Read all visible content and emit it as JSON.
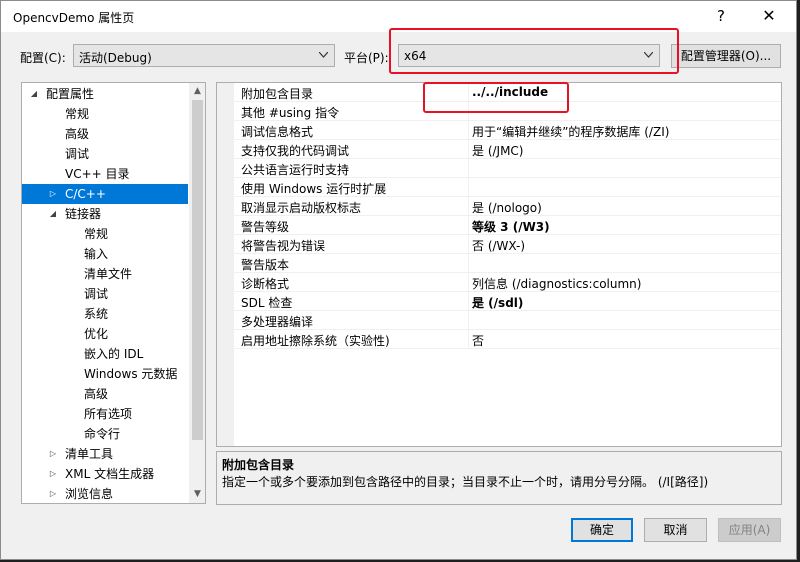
{
  "window": {
    "title": "OpencvDemo 属性页"
  },
  "titlebar": {
    "help": "?",
    "close": "✕"
  },
  "config": {
    "label": "配置(C):",
    "value": "活动(Debug)"
  },
  "platform": {
    "label": "平台(P):",
    "value": "x64"
  },
  "config_manager": {
    "label": "配置管理器(O)..."
  },
  "tree": {
    "items": [
      {
        "label": "配置属性",
        "twisty": "◢"
      },
      {
        "label": "常规"
      },
      {
        "label": "高级"
      },
      {
        "label": "调试"
      },
      {
        "label": "VC++ 目录"
      },
      {
        "label": "C/C++",
        "twisty": "▷",
        "selected": true
      },
      {
        "label": "链接器",
        "twisty": "◢"
      },
      {
        "label": "常规"
      },
      {
        "label": "输入"
      },
      {
        "label": "清单文件"
      },
      {
        "label": "调试"
      },
      {
        "label": "系统"
      },
      {
        "label": "优化"
      },
      {
        "label": "嵌入的 IDL"
      },
      {
        "label": "Windows 元数据"
      },
      {
        "label": "高级"
      },
      {
        "label": "所有选项"
      },
      {
        "label": "命令行"
      },
      {
        "label": "清单工具",
        "twisty": "▷"
      },
      {
        "label": "XML 文档生成器",
        "twisty": "▷"
      },
      {
        "label": "浏览信息",
        "twisty": "▷"
      }
    ]
  },
  "properties": [
    {
      "name": "附加包含目录",
      "value": "../../include",
      "bold": true
    },
    {
      "name": "其他 #using 指令",
      "value": ""
    },
    {
      "name": "调试信息格式",
      "value": "用于“编辑并继续”的程序数据库 (/ZI)"
    },
    {
      "name": "支持仅我的代码调试",
      "value": "是 (/JMC)"
    },
    {
      "name": "公共语言运行时支持",
      "value": ""
    },
    {
      "name": "使用 Windows 运行时扩展",
      "value": ""
    },
    {
      "name": "取消显示启动版权标志",
      "value": "是 (/nologo)"
    },
    {
      "name": "警告等级",
      "value": "等级 3 (/W3)",
      "bold": true
    },
    {
      "name": "将警告视为错误",
      "value": "否 (/WX-)"
    },
    {
      "name": "警告版本",
      "value": ""
    },
    {
      "name": "诊断格式",
      "value": "列信息 (/diagnostics:column)"
    },
    {
      "name": "SDL 检查",
      "value": "是 (/sdl)",
      "bold": true
    },
    {
      "name": "多处理器编译",
      "value": ""
    },
    {
      "name": "启用地址擦除系统（实验性)",
      "value": "否"
    }
  ],
  "description": {
    "title": "附加包含目录",
    "text": "指定一个或多个要添加到包含路径中的目录；当目录不止一个时，请用分号分隔。    (/I[路径])"
  },
  "buttons": {
    "ok": "确定",
    "cancel": "取消",
    "apply": "应用(A)"
  },
  "colors": {
    "selection": "#0078d7",
    "highlight_box": "#e81123"
  }
}
